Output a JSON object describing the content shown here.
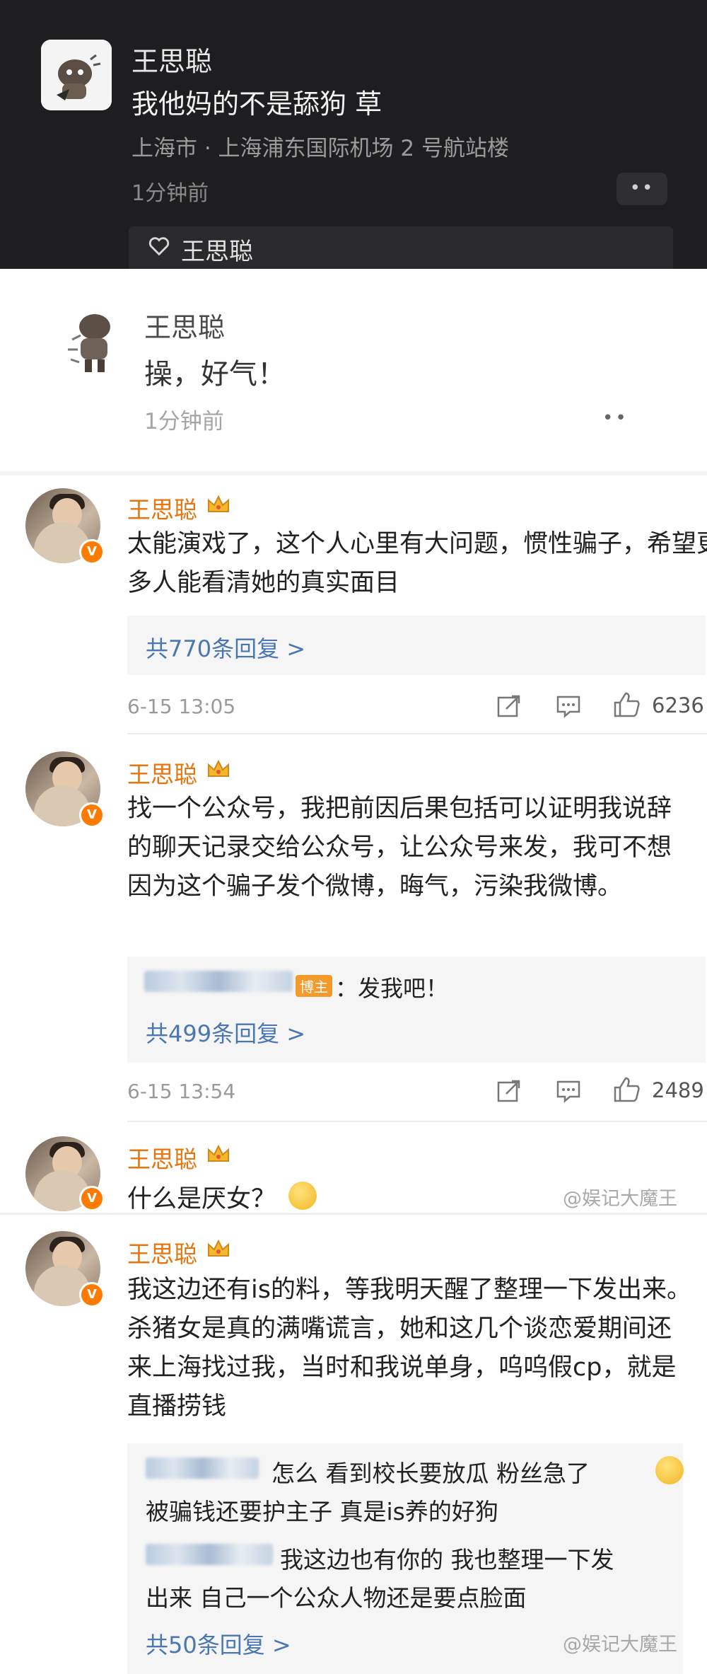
{
  "dark_post": {
    "name": "王思聪",
    "text": "我他妈的不是舔狗 草",
    "location": "上海市 · 上海浦东国际机场 2 号航站楼",
    "time": "1分钟前",
    "more": "••",
    "liker": "王思聪"
  },
  "light_comment": {
    "name": "王思聪",
    "text": "操，好气！",
    "time": "1分钟前",
    "more": "••"
  },
  "comments": [
    {
      "name": "王思聪",
      "text": "太能演戏了，这个人心里有大问题，惯性骗子，希望更多人能看清她的真实面目",
      "replies_link": "共770条回复 >",
      "time": "6-15 13:05",
      "likes": "6236"
    },
    {
      "name": "王思聪",
      "text": "找一个公众号，我把前因后果包括可以证明我说辞的聊天记录交给公众号，让公众号来发，我可不想因为这个骗子发个微博，晦气，污染我微博。",
      "host_tag": "博主",
      "host_reply": "：发我吧！",
      "replies_link": "共499条回复 >",
      "time": "6-15 13:54",
      "likes": "2489"
    },
    {
      "name": "王思聪",
      "text": "什么是厌女？"
    },
    {
      "name": "王思聪",
      "text": "我这边还有is的料，等我明天醒了整理一下发出来。杀猪女是真的满嘴谎言，她和这几个谈恋爱期间还来上海找过我，当时和我说单身，呜呜假cp，就是直播捞钱",
      "reply1": "怎么 看到校长要放瓜 粉丝急了",
      "reply1b": "被骗钱还要护主子 真是is养的好狗",
      "reply2": "我这边也有你的 我也整理一下发",
      "reply2b": "出来 自己一个公众人物还是要点脸面",
      "replies_link": "共50条回复 >"
    }
  ],
  "watermark": "@娱记大魔王",
  "colors": {
    "name_orange": "#e8740e",
    "link_blue": "#4a76b1",
    "vip_orange": "#ff7b00"
  }
}
